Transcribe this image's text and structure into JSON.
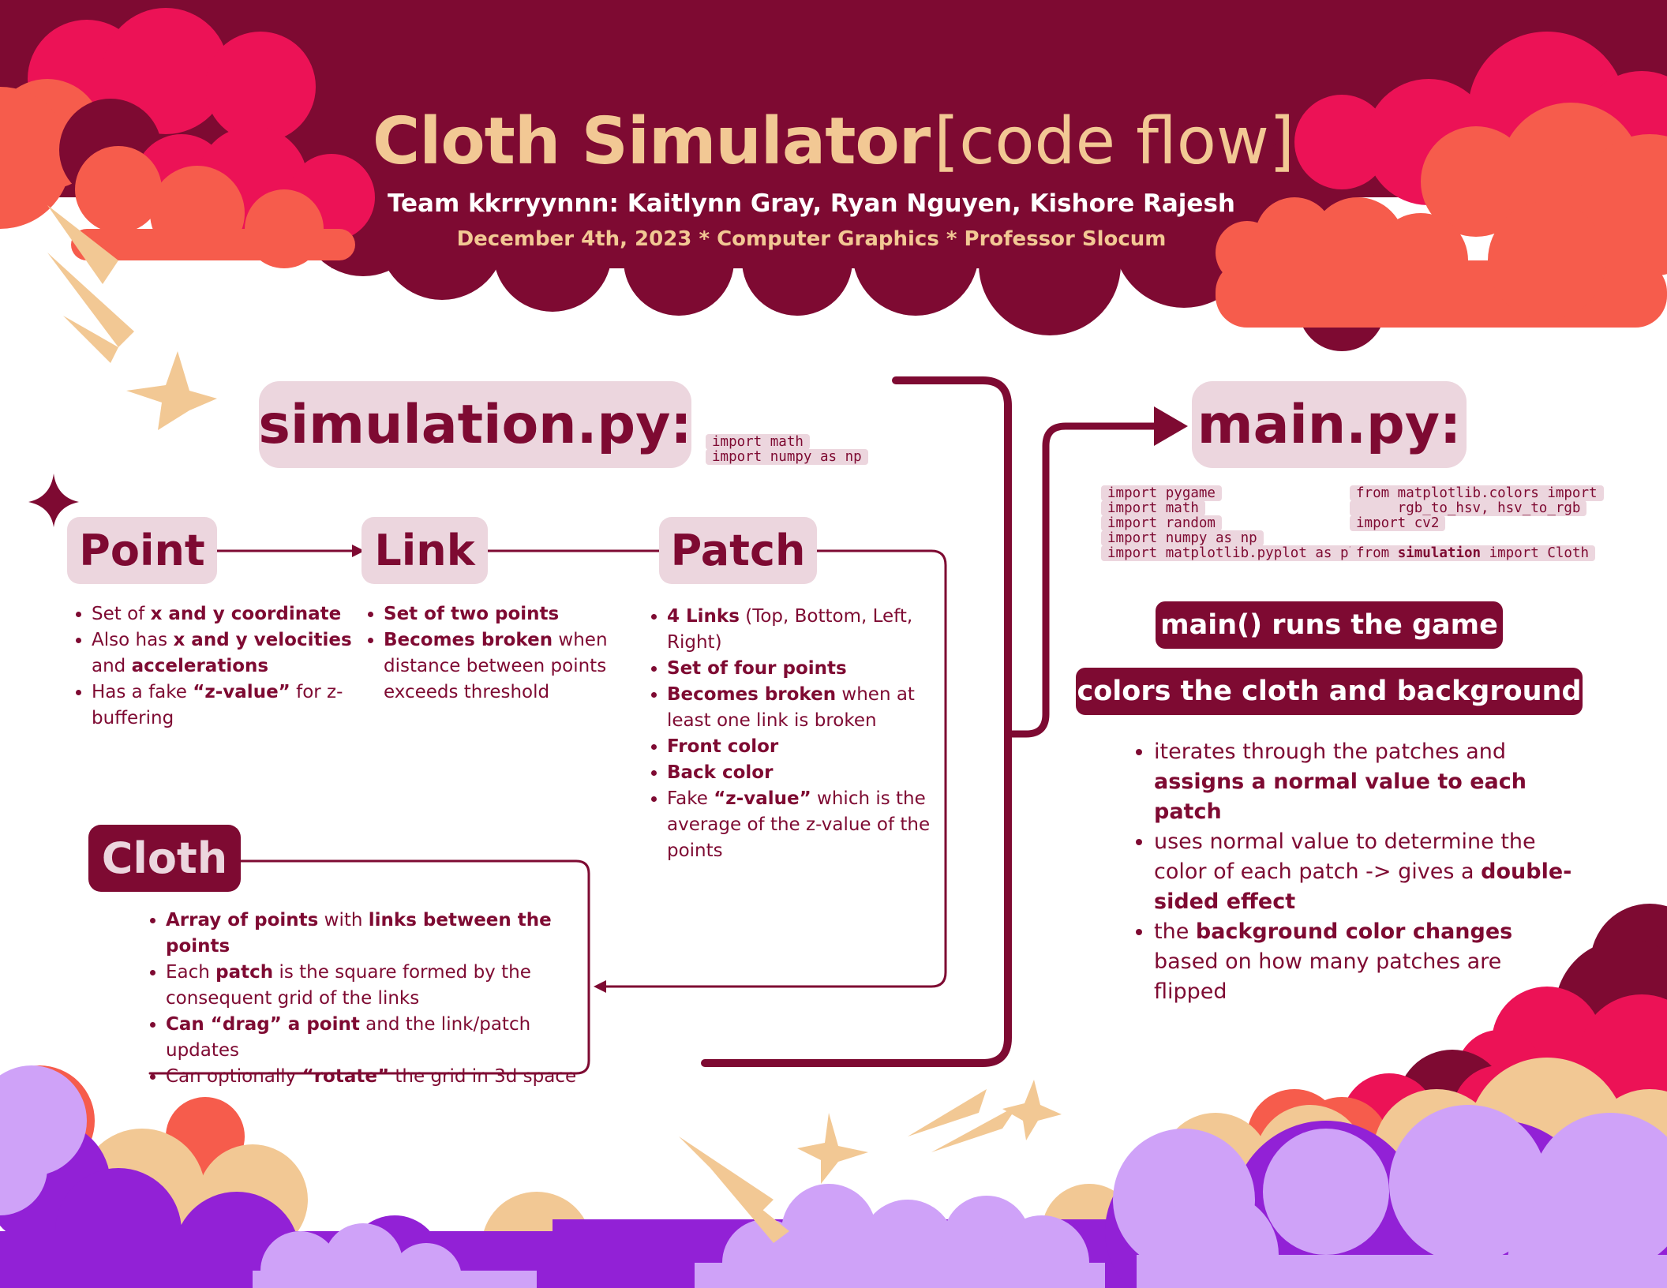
{
  "header": {
    "title_bold": "Cloth Simulator",
    "title_light": "[code flow]",
    "team": "Team kkrryynnn: Kaitlynn Gray, Ryan Nguyen, Kishore Rajesh",
    "date": "December 4th, 2023 * Computer Graphics * Professor Slocum"
  },
  "simulation": {
    "label": "simulation.py:",
    "imports": [
      "import math",
      "import numpy as np"
    ]
  },
  "point": {
    "label": "Point",
    "bullets": [
      [
        {
          "t": "Set of "
        },
        {
          "t": "x and y coordinate",
          "b": true
        }
      ],
      [
        {
          "t": "Also has "
        },
        {
          "t": "x and y velocities",
          "b": true
        },
        {
          "t": " and "
        },
        {
          "t": "accelerations",
          "b": true
        }
      ],
      [
        {
          "t": "Has a fake "
        },
        {
          "t": "“z-value”",
          "b": true
        },
        {
          "t": " for z-buffering"
        }
      ]
    ]
  },
  "link": {
    "label": "Link",
    "bullets": [
      [
        {
          "t": "Set of two points",
          "b": true
        }
      ],
      [
        {
          "t": "Becomes broken",
          "b": true
        },
        {
          "t": " when distance between points exceeds threshold"
        }
      ]
    ]
  },
  "patch": {
    "label": "Patch",
    "bullets": [
      [
        {
          "t": "4 Links",
          "b": true
        },
        {
          "t": " (Top, Bottom, Left, Right)"
        }
      ],
      [
        {
          "t": "Set of four points",
          "b": true
        }
      ],
      [
        {
          "t": "Becomes broken",
          "b": true
        },
        {
          "t": " when at least one link is broken"
        }
      ],
      [
        {
          "t": "Front color",
          "b": true
        }
      ],
      [
        {
          "t": "Back color",
          "b": true
        }
      ],
      [
        {
          "t": "Fake "
        },
        {
          "t": "“z-value”",
          "b": true
        },
        {
          "t": " which is the average of the z-value of the points"
        }
      ]
    ]
  },
  "cloth": {
    "label": "Cloth",
    "bullets": [
      [
        {
          "t": "Array of points",
          "b": true
        },
        {
          "t": " with "
        },
        {
          "t": "links between the points",
          "b": true
        }
      ],
      [
        {
          "t": "Each "
        },
        {
          "t": "patch",
          "b": true
        },
        {
          "t": " is the square formed by the consequent grid of the links"
        }
      ],
      [
        {
          "t": "Can “drag” a point",
          "b": true
        },
        {
          "t": " and the link/patch updates"
        }
      ],
      [
        {
          "t": "Can optionally "
        },
        {
          "t": "“rotate”",
          "b": true
        },
        {
          "t": " the grid in 3d space"
        }
      ]
    ]
  },
  "main": {
    "label": "main.py:",
    "imports_left": [
      "import pygame",
      "import math",
      "import random",
      "import numpy as np",
      "import matplotlib.pyplot as plt"
    ],
    "imports_right": [
      [
        {
          "t": "from matplotlib.colors import"
        }
      ],
      [
        {
          "t": "     rgb_to_hsv, hsv_to_rgb"
        }
      ],
      [
        {
          "t": "import cv2"
        }
      ],
      [
        {
          "t": ""
        }
      ],
      [
        {
          "t": "from "
        },
        {
          "t": "simulation",
          "b": true
        },
        {
          "t": " import Cloth"
        }
      ]
    ],
    "runs": "main() runs the game",
    "colors": "colors the cloth and background",
    "bullets": [
      [
        {
          "t": "iterates through the patches and "
        },
        {
          "t": "assigns a normal value to each patch",
          "b": true
        }
      ],
      [
        {
          "t": "uses normal value to determine the color of each patch -> gives a "
        },
        {
          "t": "double-sided effect",
          "b": true
        }
      ],
      [
        {
          "t": "the "
        },
        {
          "t": "background color changes",
          "b": true
        },
        {
          "t": " based on how many patches are flipped"
        }
      ]
    ]
  },
  "colors": {
    "maroon": "#7e0a32",
    "pink_pill": "#ecd6de",
    "cream": "#f2c894",
    "hot_pink": "#ec1256",
    "coral": "#f65c4c",
    "purple": "#9221d6",
    "lavender": "#cfa2f8"
  }
}
